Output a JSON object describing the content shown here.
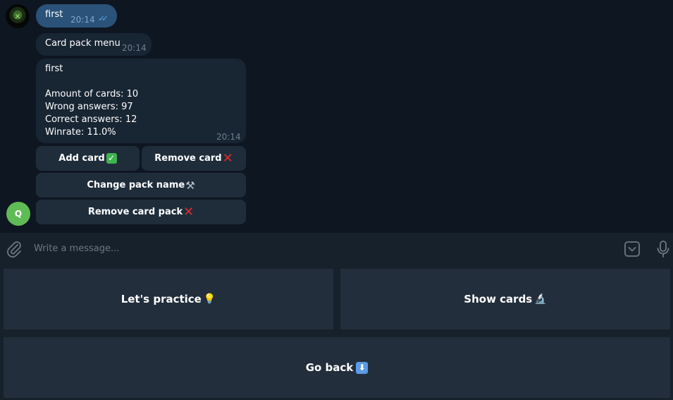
{
  "chat": {
    "bot_avatar_letter": "Q",
    "outgoing": {
      "text": "first",
      "time": "20:14",
      "status_icon": "double-check-icon"
    },
    "menu_message": {
      "text": "Card pack menu",
      "time": "20:14"
    },
    "info_message": {
      "title": "first",
      "amount": "Amount of cards: 10",
      "wrong": "Wrong answers: 97",
      "correct": "Correct answers: 12",
      "winrate": "Winrate: 11.0%",
      "time": "20:14"
    },
    "inline_buttons": {
      "add": "Add card",
      "remove": "Remove card",
      "rename": "Change pack name",
      "remove_pack": "Remove card pack"
    }
  },
  "composer": {
    "placeholder": "Write a message..."
  },
  "reply_keyboard": {
    "practice": "Let's practice",
    "show": "Show cards",
    "back": "Go back"
  },
  "colors": {
    "chat_bg": "#0e1621",
    "outgoing_bubble": "#2b5278",
    "incoming_bubble": "#182533",
    "panel_bg": "#17212b",
    "key_bg": "#232e3c"
  }
}
